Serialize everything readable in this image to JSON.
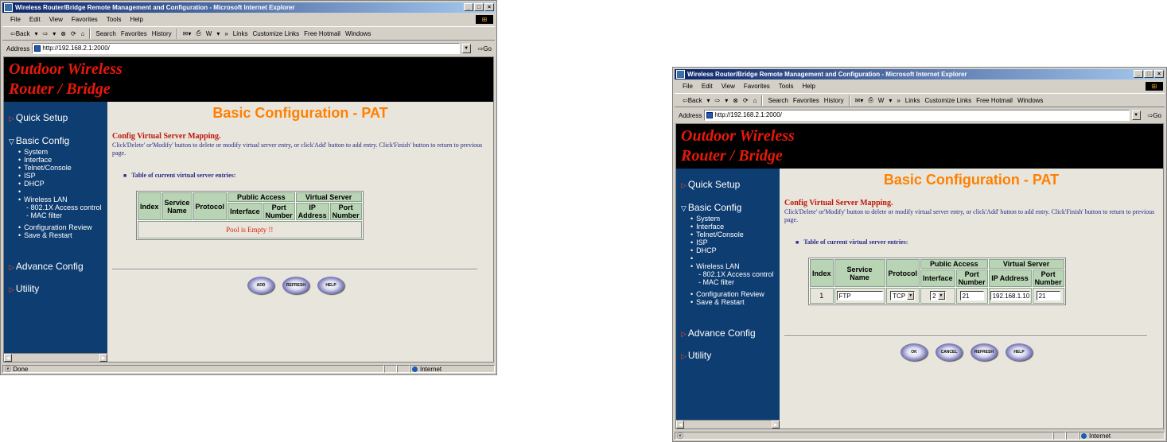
{
  "ie": {
    "title": "Wireless Router/Bridge Remote Management and Configuration - Microsoft Internet Explorer",
    "menu": [
      "File",
      "Edit",
      "View",
      "Favorites",
      "Tools",
      "Help"
    ],
    "toolbar": [
      "⇦Back",
      "▾",
      "⇨",
      "▾",
      "⊗",
      "⟳",
      "⌂",
      "Search",
      "Favorites",
      "History",
      "✉▾",
      "⎙",
      "W",
      "▾",
      "»",
      "Links",
      "Customize Links",
      "Free Hotmail",
      "Windows"
    ],
    "address_label": "Address",
    "url": "http://192.168.2.1:2000/",
    "go": "Go"
  },
  "banner": {
    "line1": "Outdoor Wireless",
    "line2": "Router / Bridge"
  },
  "sidebar": {
    "quick_setup": "Quick Setup",
    "basic_config": "Basic Config",
    "items": [
      "System",
      "Interface",
      "Telnet/Console",
      "ISP",
      "DHCP",
      "",
      "Wireless LAN"
    ],
    "subitems": [
      "- 802.1X Access control",
      "- MAC filter"
    ],
    "items2": [
      "Configuration Review",
      "Save & Restart"
    ],
    "advance_config": "Advance Config",
    "utility": "Utility"
  },
  "page": {
    "heading": "Basic Configuration - PAT",
    "config_title": "Config Virtual Server Mapping.",
    "config_desc": "Click'Delete' or'Modify' button to delete or modify virtual server entry, or click'Add' button to add entry. Click'Finish' button to return to previous page.",
    "table_title": "Table of current virtual server entries:"
  },
  "table": {
    "col_index": "Index",
    "col_service_name": "Service Name",
    "col_protocol": "Protocol",
    "group_public": "Public Access",
    "group_virtual": "Virtual Server",
    "col_interface": "Interface",
    "col_port_number": "Port Number",
    "col_ip_address": "IP Address",
    "col_port_number2": "Port Number"
  },
  "win1": {
    "empty_message": "Pool is Empty !!",
    "buttons": [
      "ADD",
      "REFRESH",
      "HELP"
    ],
    "status_left": "Done",
    "status_zone": "Internet"
  },
  "win2": {
    "row": {
      "index": "1",
      "service_name": "FTP",
      "protocol": "TCP",
      "interface": "2",
      "public_port": "21",
      "ip_address": "192.168.1.10",
      "virtual_port": "21"
    },
    "buttons": [
      "OK",
      "CANCEL",
      "REFRESH",
      "HELP"
    ],
    "status_left": "",
    "status_zone": "Internet"
  }
}
